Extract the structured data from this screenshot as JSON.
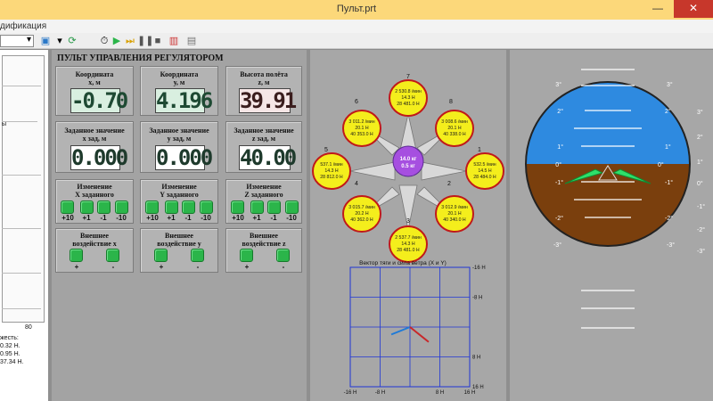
{
  "window": {
    "title": "Пульт.prt",
    "minimize_label": "—",
    "maximize_label": "□",
    "close_label": "✕"
  },
  "menu": {
    "item": "дификация"
  },
  "toolbar": {
    "icons": [
      "run-icon",
      "play-icon",
      "step-icon",
      "pause-icon",
      "stop-icon",
      "chart-icon",
      "document-icon"
    ]
  },
  "left_panel": {
    "lines": [
      "жесть:",
      "0.32 Н.",
      "0.95 Н.",
      "37.34 Н."
    ],
    "axis_label": "80",
    "marker": "ы"
  },
  "control_panel": {
    "title": "ПУЛЬТ УПРАВЛЕНИЯ РЕГУЛЯТОРОМ",
    "x_coord": {
      "label": "Координата\nх, м",
      "value": "-0.70"
    },
    "y_coord": {
      "label": "Координата\nу, м",
      "value": "4.196"
    },
    "z_coord": {
      "label": "Высота полёта\nz, м",
      "value": "39.91"
    },
    "x_set": {
      "label": "Заданное значение\nх зад, м",
      "value": "0.000"
    },
    "y_set": {
      "label": "Заданное значение\nу зад, м",
      "value": "0.000"
    },
    "z_set": {
      "label": "Заданное значение\nz зад, м",
      "value": "40.00"
    },
    "x_change": {
      "label": "Изменение\nX заданного",
      "buttons": [
        "+10",
        "+1",
        "-1",
        "-10"
      ]
    },
    "y_change": {
      "label": "Изменение\nY заданного",
      "buttons": [
        "+10",
        "+1",
        "-1",
        "-10"
      ]
    },
    "z_change": {
      "label": "Изменение\nZ заданного",
      "buttons": [
        "+10",
        "+1",
        "-1",
        "-10"
      ]
    },
    "x_ext": {
      "label": "Внешнее\nвоздействие х",
      "buttons": [
        "+",
        "-"
      ]
    },
    "y_ext": {
      "label": "Внешнее\nвоздействие у",
      "buttons": [
        "+",
        "-"
      ]
    },
    "z_ext": {
      "label": "Внешнее\nвоздействие z",
      "buttons": [
        "+",
        "-"
      ]
    }
  },
  "rotors": {
    "center": {
      "line1": "14.0 кг",
      "line2": "0.5 кг"
    },
    "items": [
      {
        "id": "1",
        "lines": [
          "532.5 /мин",
          "14.5 Н",
          "28 484.0 Н"
        ]
      },
      {
        "id": "2",
        "lines": [
          "3 012.9 /мин",
          "20.1 Н",
          "40 340.0 Н"
        ]
      },
      {
        "id": "3",
        "lines": [
          "2 537.7 /мин",
          "14.3 Н",
          "28 481.0 Н"
        ]
      },
      {
        "id": "4",
        "lines": [
          "3 015.7 /мин",
          "20.2 Н",
          "40 362.0 Н"
        ]
      },
      {
        "id": "5",
        "lines": [
          "537.1 /мин",
          "14.3 Н",
          "28 812.0 Н"
        ]
      },
      {
        "id": "6",
        "lines": [
          "3 011.2 /мин",
          "20.1 Н",
          "40 353.0 Н"
        ]
      },
      {
        "id": "7",
        "lines": [
          "2 530.8 /мин",
          "14.3 Н",
          "28 481.0 Н"
        ]
      },
      {
        "id": "8",
        "lines": [
          "3 008.6 /мин",
          "20.1 Н",
          "40 338.0 Н"
        ]
      }
    ]
  },
  "chart_data": {
    "type": "scatter",
    "title": "Вектор тяги и сила ветра (X и Y)",
    "xlim": [
      -16,
      16
    ],
    "ylim": [
      -16,
      16
    ],
    "x_ticks": [
      "-16 Н",
      "-8 Н",
      "8 Н",
      "16 Н"
    ],
    "y_ticks": [
      "-16 Н",
      "-8 Н",
      "8 Н",
      "16 Н"
    ],
    "series": [
      {
        "color": "#1e7ad8",
        "x": [
          0,
          -5
        ],
        "y": [
          0,
          -2
        ]
      },
      {
        "color": "#c8282a",
        "x": [
          0,
          5
        ],
        "y": [
          0,
          -4
        ]
      }
    ]
  },
  "attitude": {
    "sky_color": "#2e8ae0",
    "ground_color": "#7a3f0d",
    "center_left": "0°",
    "center_right": "0°",
    "marks_left": [
      "3°",
      "2°",
      "1°",
      "-1°",
      "-2°",
      "-3°"
    ],
    "marks_right": [
      "3°",
      "2°",
      "1°",
      "-1°",
      "-2°",
      "-3°"
    ],
    "roll_marks": [
      "3°",
      "2°",
      "1°",
      "0°",
      "-1°",
      "-2°",
      "-3°"
    ]
  }
}
